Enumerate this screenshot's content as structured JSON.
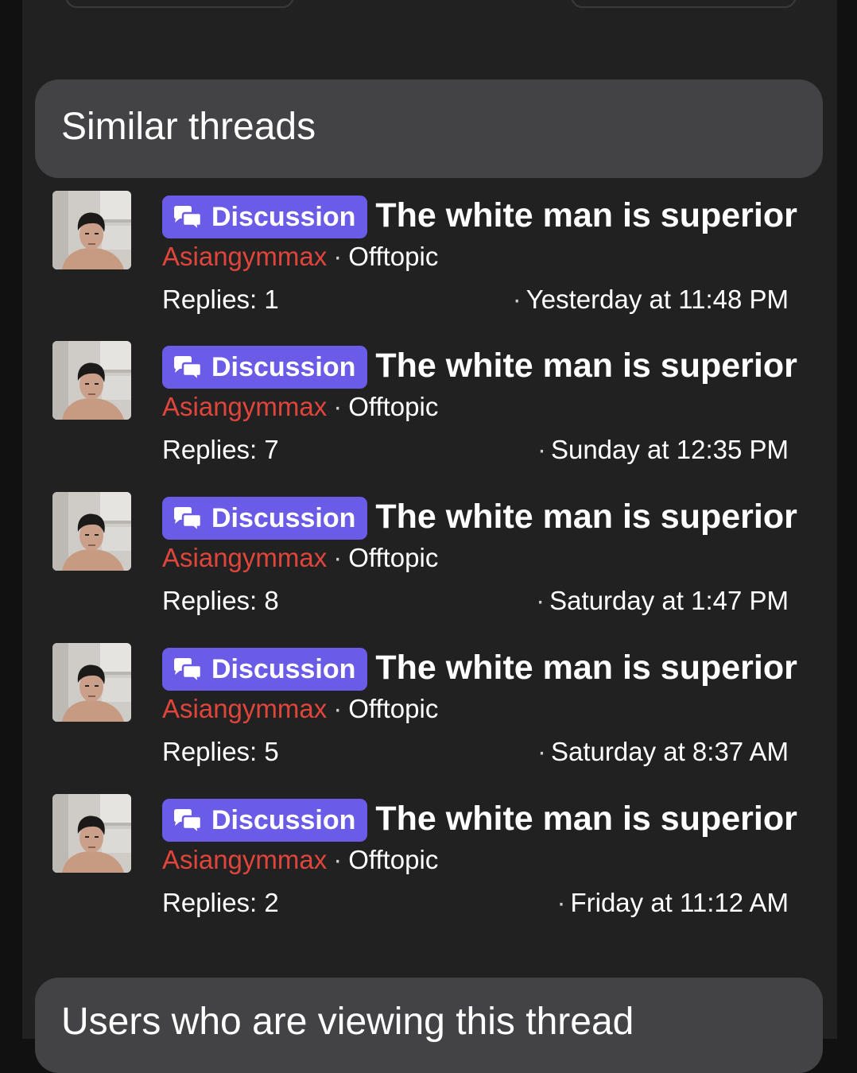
{
  "sections": {
    "similar_title": "Similar threads",
    "viewing_title": "Users who are viewing this thread"
  },
  "icons": {
    "prefix_icon": "chat-bubbles-icon",
    "avatar": "user-photo-avatar"
  },
  "colors": {
    "prefix_bg": "#6b5ce7",
    "author": "#e0453b",
    "panel": "#434345",
    "background": "#212122"
  },
  "threads": [
    {
      "prefix": "Discussion",
      "title": "The white man is superior",
      "author": "Asiangymmax",
      "separator": "·",
      "forum": "Offtopic",
      "replies": "Replies: 1",
      "date_dot": "·",
      "date": "Yesterday at 11:48 PM"
    },
    {
      "prefix": "Discussion",
      "title": "The white man is superior",
      "author": "Asiangymmax",
      "separator": "·",
      "forum": "Offtopic",
      "replies": "Replies: 7",
      "date_dot": "·",
      "date": "Sunday at 12:35 PM"
    },
    {
      "prefix": "Discussion",
      "title": "The white man is superior",
      "author": "Asiangymmax",
      "separator": "·",
      "forum": "Offtopic",
      "replies": "Replies: 8",
      "date_dot": "·",
      "date": "Saturday at 1:47 PM"
    },
    {
      "prefix": "Discussion",
      "title": "The white man is superior",
      "author": "Asiangymmax",
      "separator": "·",
      "forum": "Offtopic",
      "replies": "Replies: 5",
      "date_dot": "·",
      "date": "Saturday at 8:37 AM"
    },
    {
      "prefix": "Discussion",
      "title": "The white man is superior",
      "author": "Asiangymmax",
      "separator": "·",
      "forum": "Offtopic",
      "replies": "Replies: 2",
      "date_dot": "·",
      "date": "Friday at 11:12 AM"
    }
  ]
}
